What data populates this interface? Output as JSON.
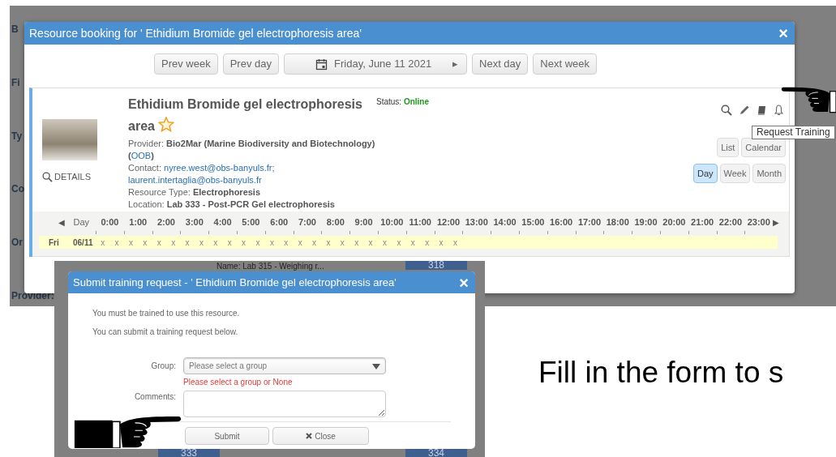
{
  "background_app": {
    "labels": [
      "B",
      "Fi",
      "Ty",
      "Co",
      "Or",
      "Provider:"
    ]
  },
  "booking_dialog": {
    "title": "Resource booking for ' Ethidium Bromide gel electrophoresis area'",
    "close": "×",
    "nav_buttons": [
      {
        "kind": "plain",
        "label": "Prev week"
      },
      {
        "kind": "plain",
        "label": "Prev day"
      },
      {
        "kind": "date",
        "label": "Friday, June 11 2021",
        "arrow": "▸"
      },
      {
        "kind": "plain",
        "label": "Next day"
      },
      {
        "kind": "plain",
        "label": "Next week"
      }
    ],
    "resource": {
      "name": "Ethidium Bromide gel electrophoresis area",
      "favorite": true,
      "details": "DETAILS",
      "status_label": "Status:",
      "status": "Online",
      "lines": [
        {
          "label": "Provider:",
          "parts": [
            {
              "text": "Bio2Mar (Marine Biodiversity and Biotechnology) (",
              "link": false
            },
            {
              "text": "OOB",
              "link": true
            },
            {
              "text": ")",
              "link": false
            }
          ]
        },
        {
          "label": "Contact:",
          "parts": [
            {
              "text": "nyree.west@obs-banyuls.fr;",
              "link": true
            },
            {
              "text": "laurent.intertaglia@obs-banyuls.fr",
              "link": true
            }
          ]
        },
        {
          "label": "Resource Type:",
          "parts": [
            {
              "text": "Electrophoresis",
              "link": false
            }
          ]
        },
        {
          "label": "Location:",
          "parts": [
            {
              "text": "Lab 333 - Post-PCR Gel electrophoresis",
              "link": false
            }
          ]
        }
      ],
      "tooltip": "Request Training",
      "view_buttons": [
        {
          "label": "List",
          "selected": false
        },
        {
          "label": "Calendar",
          "selected": false
        }
      ],
      "range_buttons": [
        {
          "label": "Day",
          "selected": true
        },
        {
          "label": "Week",
          "selected": false
        },
        {
          "label": "Month",
          "selected": false
        }
      ]
    },
    "timeline": {
      "prev": "◀",
      "label": "Day",
      "next": "▶",
      "hours": [
        "0:00",
        "1:00",
        "2:00",
        "3:00",
        "4:00",
        "5:00",
        "6:00",
        "7:00",
        "8:00",
        "9:00",
        "10:00",
        "11:00",
        "12:00",
        "13:00",
        "14:00",
        "15:00",
        "16:00",
        "17:00",
        "18:00",
        "19:00",
        "20:00",
        "21:00",
        "22:00",
        "23:00"
      ],
      "row": {
        "day": "Fri",
        "date": "06/11",
        "slots": [
          "x",
          "x",
          "x",
          "x",
          "x",
          "x",
          "x",
          "x",
          "x",
          "x",
          "x",
          "x",
          "x",
          "x",
          "x",
          "x",
          "x",
          "x",
          "x",
          "x",
          "x",
          "x",
          "x",
          "x",
          "x",
          "x"
        ]
      }
    }
  },
  "background_list": {
    "name": "Name: Lab 315 - Weighing r...",
    "codes": [
      "318",
      "333",
      "334"
    ]
  },
  "training_dialog": {
    "title": "Submit training request - ' Ethidium Bromide gel electrophoresis area'",
    "close": "×",
    "messages": [
      "You must be trained to use this resource.",
      "You can submit a training request below."
    ],
    "group_label": "Group:",
    "group": {
      "placeholder": "Please select a group"
    },
    "group_error": "Please select a group or None",
    "comments_label": "Comments:",
    "buttons": [
      {
        "kind": "submit",
        "label": "Submit"
      },
      {
        "kind": "close",
        "label": "Close"
      }
    ]
  },
  "slide_text": "Fill in the form to s"
}
